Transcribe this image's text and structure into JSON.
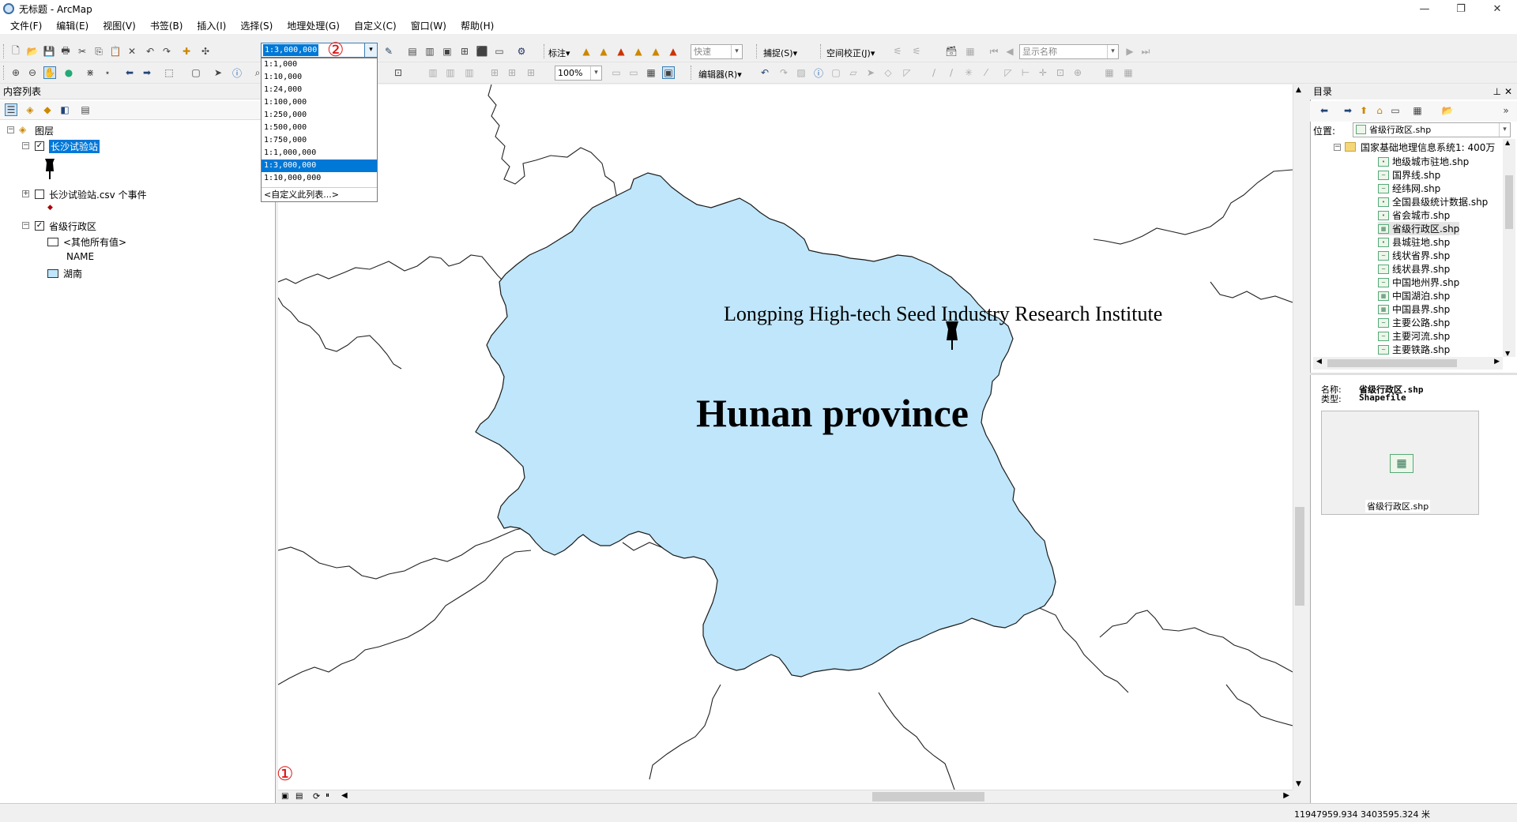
{
  "window": {
    "title": "无标题 - ArcMap",
    "controls": [
      "—",
      "❐",
      "✕"
    ]
  },
  "menu": [
    "文件(F)",
    "编辑(E)",
    "视图(V)",
    "书签(B)",
    "插入(I)",
    "选择(S)",
    "地理处理(G)",
    "自定义(C)",
    "窗口(W)",
    "帮助(H)"
  ],
  "toolbar": {
    "scale_value": "1:3,000,000",
    "scale_options": [
      "1:1,000",
      "1:10,000",
      "1:24,000",
      "1:100,000",
      "1:250,000",
      "1:500,000",
      "1:750,000",
      "1:1,000,000",
      "1:3,000,000",
      "1:10,000,000"
    ],
    "scale_selected": "1:3,000,000",
    "scale_custom": "<自定义此列表...>",
    "label_menu": "标注▾",
    "speed_combo": "快速",
    "snap_menu": "捕捉(S)▾",
    "spatial_adjust": "空间校正(J)▾",
    "display_name_combo": "显示名称",
    "zoom_percent": "100%",
    "editor_menu": "编辑器(R)▾"
  },
  "annotations": {
    "mark1": "①",
    "mark2": "②"
  },
  "toc": {
    "header": "内容列表",
    "root": "图层",
    "layers": [
      {
        "name": "长沙试验站",
        "checked": true,
        "selected": true
      },
      {
        "name": "长沙试验站.csv 个事件",
        "checked": false,
        "selected": false
      },
      {
        "name": "省级行政区",
        "checked": true,
        "selected": false
      }
    ],
    "legend": {
      "other_values": "<其他所有值>",
      "field": "NAME",
      "hunan": "湖南"
    }
  },
  "map": {
    "institute_label": "Longping High-tech Seed Industry Research Institute",
    "province_label": "Hunan province",
    "fill_color": "#bfe6fa"
  },
  "catalog": {
    "header": "目录",
    "location_label": "位置:",
    "location_value": "省级行政区.shp",
    "root_folder": "国家基础地理信息系统1: 400万",
    "items": [
      "地级城市驻地.shp",
      "国界线.shp",
      "经纬网.shp",
      "全国县级统计数据.shp",
      "省会城市.shp",
      "省级行政区.shp",
      "县城驻地.shp",
      "线状省界.shp",
      "线状县界.shp",
      "中国地州界.shp",
      "中国湖泊.shp",
      "中国县界.shp",
      "主要公路.shp",
      "主要河流.shp",
      "主要铁路.shp"
    ],
    "selected_item": "省级行政区.shp",
    "name_label": "名称:",
    "name_value": "省级行政区.shp",
    "type_label": "类型:",
    "type_value": "Shapefile",
    "preview_caption": "省级行政区.shp"
  },
  "status": {
    "coordinates": "11947959.934  3403595.324 米"
  }
}
